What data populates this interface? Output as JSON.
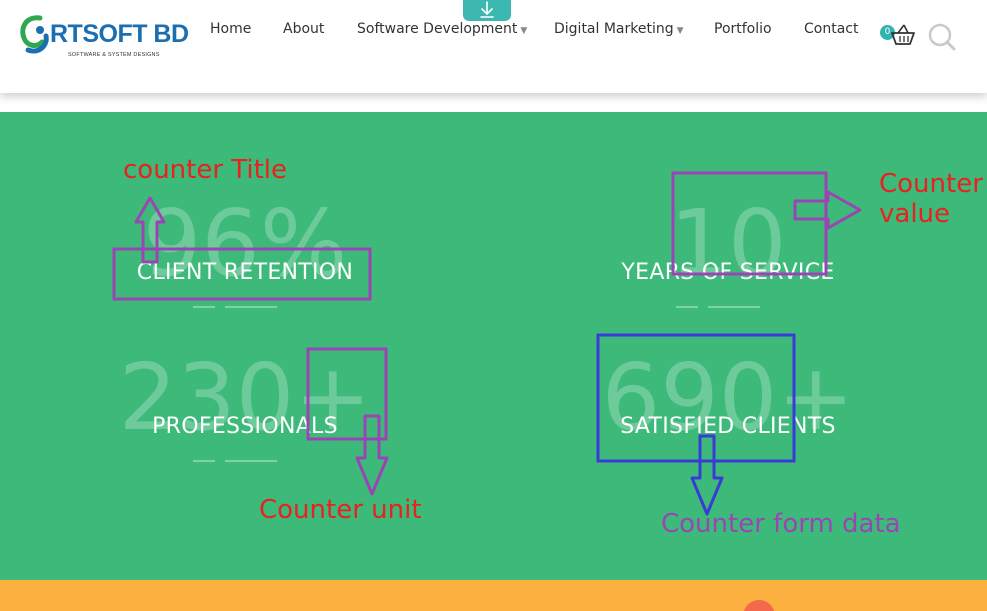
{
  "brand": {
    "name": "RTSOFT BD",
    "tagline": "SOFTWARE & SYSTEM DESIGNS"
  },
  "nav": {
    "items": [
      {
        "label": "Home",
        "dropdown": false
      },
      {
        "label": "About",
        "dropdown": false
      },
      {
        "label": "Software Development",
        "dropdown": true
      },
      {
        "label": "Digital Marketing",
        "dropdown": true
      },
      {
        "label": "Portfolio",
        "dropdown": false
      },
      {
        "label": "Contact",
        "dropdown": false
      }
    ],
    "cart_count": "0"
  },
  "counters": [
    {
      "value": "96%",
      "title": "CLIENT RETENTION"
    },
    {
      "value": "10",
      "title": "YEARS OF SERVICE"
    },
    {
      "value": "230+",
      "title": "PROFESSIONALS"
    },
    {
      "value": "690+",
      "title": "SATISFIED CLIENTS"
    }
  ],
  "annotations": {
    "counter_title": "counter Title",
    "counter_value": "Counter\nvalue",
    "counter_unit": "Counter unit",
    "counter_form_data": "Counter form data"
  },
  "colors": {
    "counter_bg": "#3db97a",
    "accent_teal": "#3cb8b0",
    "footer_band": "#fbb040",
    "annotation_red": "#e8221f",
    "annotation_purple": "#9b45b5",
    "annotation_blue": "#3a3ad8"
  }
}
